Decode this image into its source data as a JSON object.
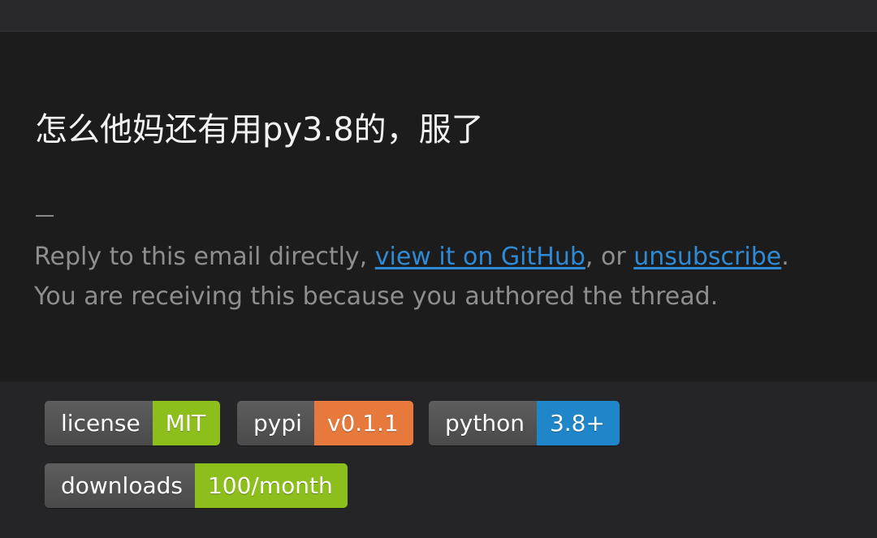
{
  "message": {
    "text": "怎么他妈还有用py3.8的，服了"
  },
  "signature": {
    "dash": "—",
    "reply_prefix": "Reply to this email directly, ",
    "view_link": "view it on GitHub",
    "mid_text": ", or ",
    "unsubscribe_link": "unsubscribe",
    "end_text": ".",
    "reason": "You are receiving this because you authored the thread."
  },
  "badges": [
    {
      "label": "license",
      "value": "MIT",
      "color": "#8cbf1b"
    },
    {
      "label": "pypi",
      "value": "v0.1.1",
      "color": "#e7793d"
    },
    {
      "label": "python",
      "value": "3.8+",
      "color": "#1f86c9"
    },
    {
      "label": "downloads",
      "value": "100/month",
      "color": "#8cbf1b"
    }
  ],
  "colors": {
    "page_bg": "#262629",
    "card_bg": "#1c1c1c",
    "link": "#2f8ad6",
    "muted_text": "#8e8e8e",
    "badge_label_bg": "#555555"
  }
}
